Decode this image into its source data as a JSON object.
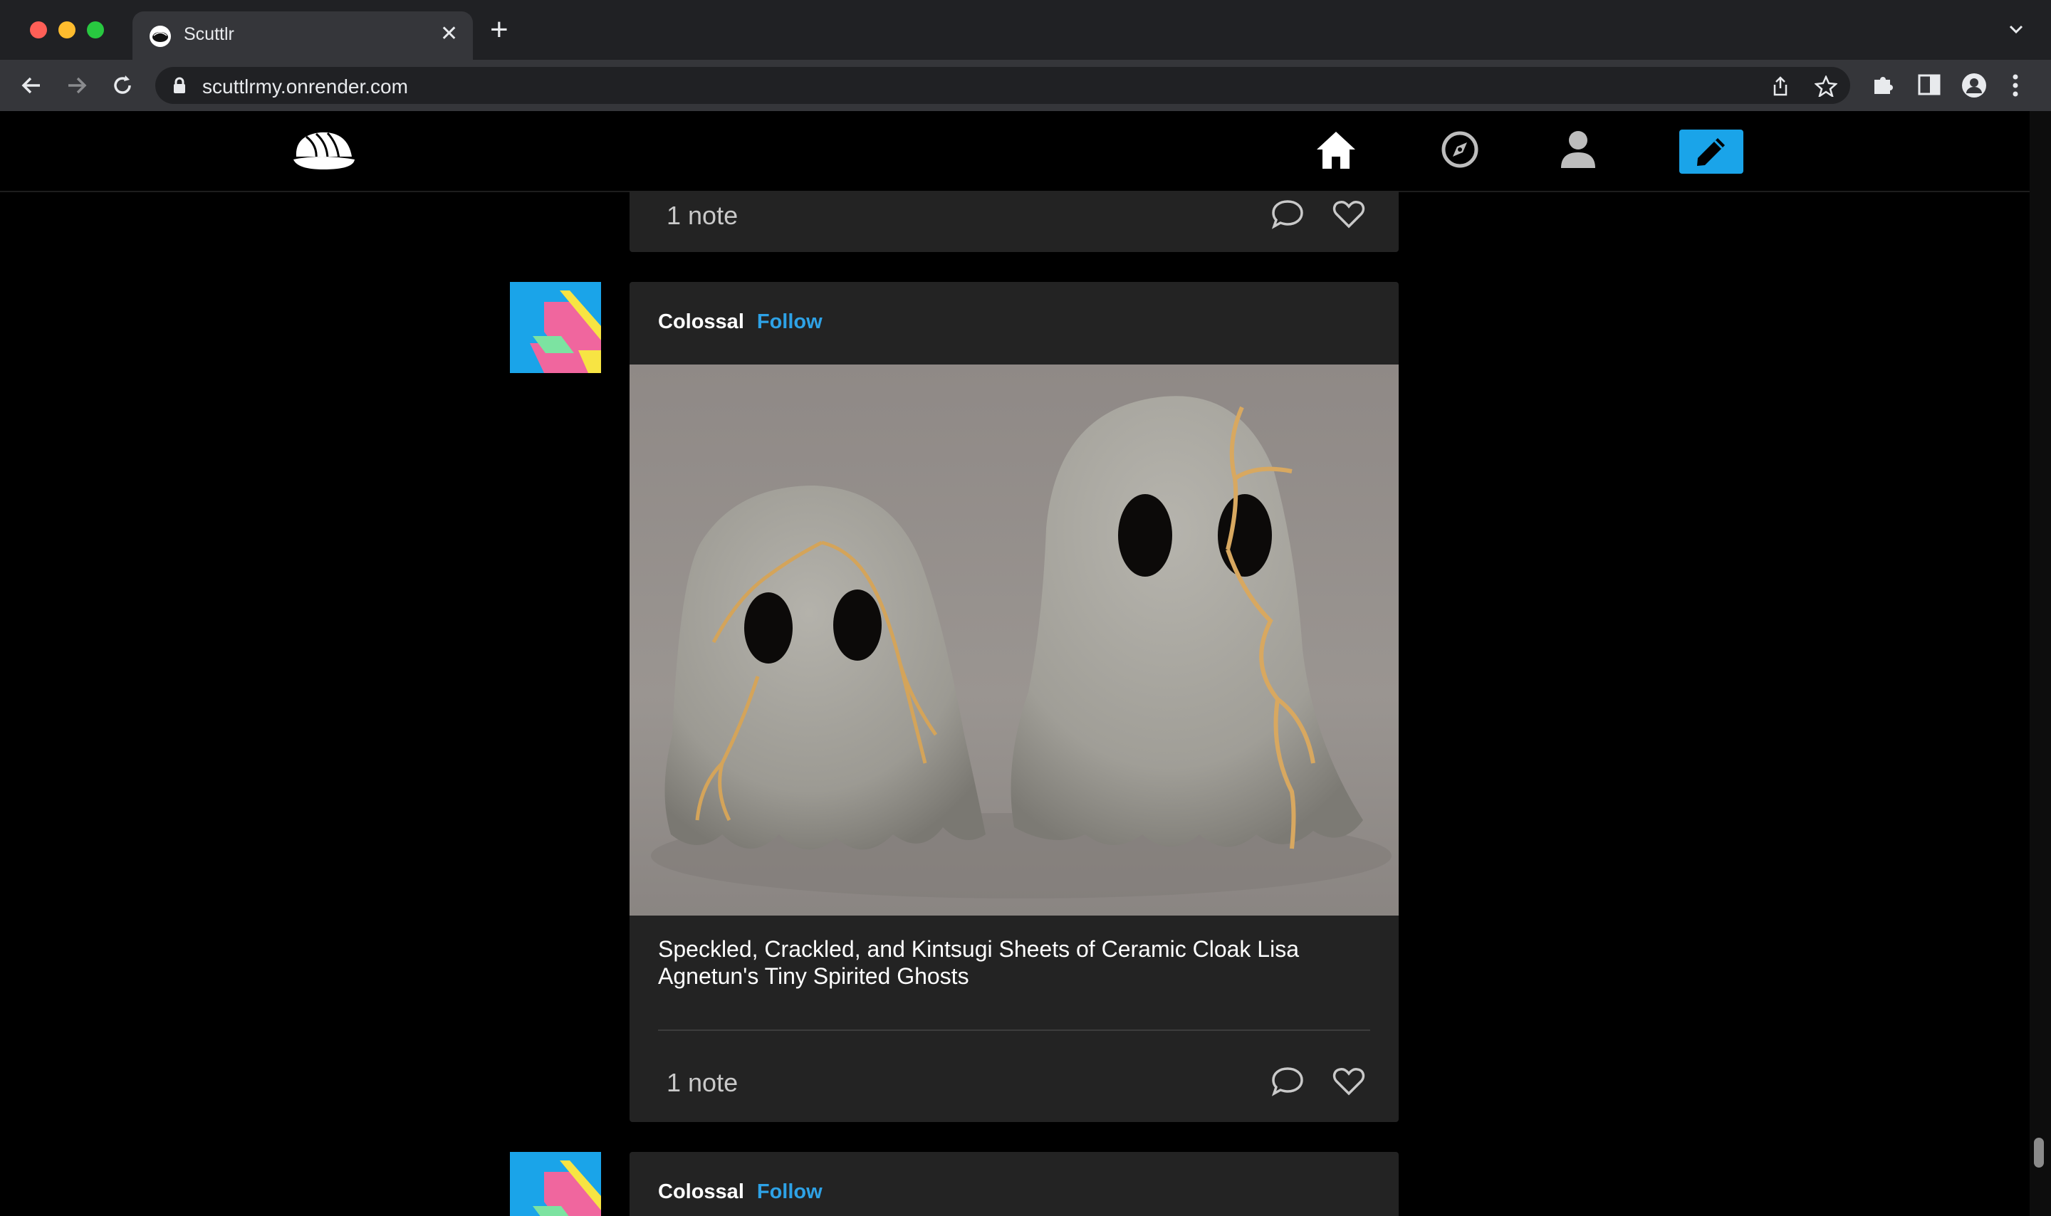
{
  "browser": {
    "tab_title": "Scuttlr",
    "url": "scuttlrmy.onrender.com"
  },
  "site": {
    "name": "Scuttlr",
    "accent_color": "#1aa4e9",
    "nav": [
      {
        "name": "home-icon"
      },
      {
        "name": "explore-icon"
      },
      {
        "name": "profile-icon"
      },
      {
        "name": "compose-icon"
      }
    ]
  },
  "feed": {
    "prev_post": {
      "notes": "1 note"
    },
    "post": {
      "author": "Colossal",
      "follow_label": "Follow",
      "image_alt": "Two ceramic ghost figurines with gold kintsugi cracks",
      "caption": "Speckled, Crackled, and Kintsugi Sheets of Ceramic Cloak Lisa Agnetun's Tiny Spirited Ghosts",
      "notes": "1 note"
    },
    "next_post": {
      "author": "Colossal",
      "follow_label": "Follow"
    }
  }
}
